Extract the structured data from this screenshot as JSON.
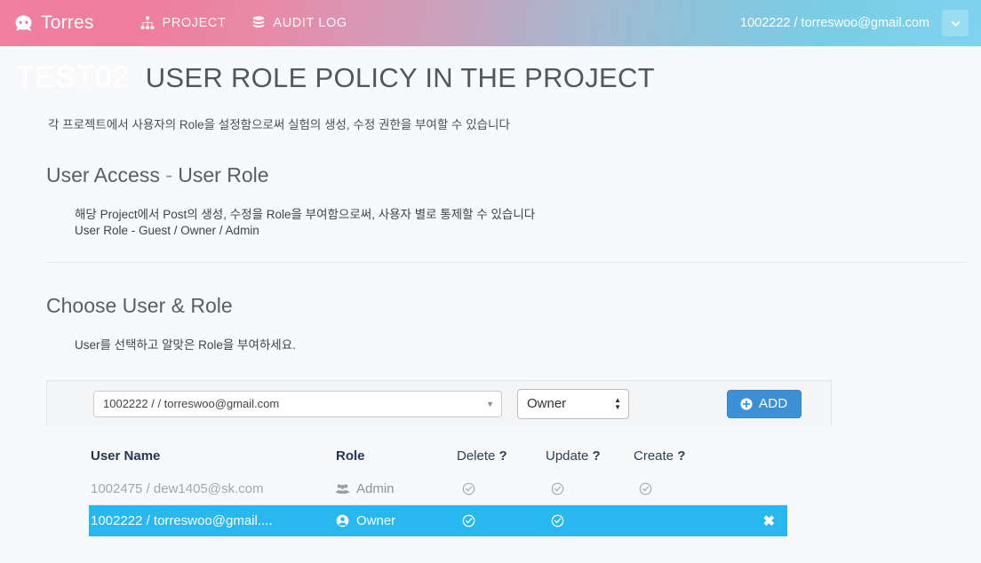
{
  "navbar": {
    "brand": "Torres",
    "brand_icon": "octoface-icon",
    "links": [
      {
        "label": "PROJECT",
        "icon": "sitemap-icon"
      },
      {
        "label": "AUDIT LOG",
        "icon": "database-icon"
      }
    ],
    "user": "1002222 / torreswoo@gmail.com",
    "caret_icon": "chevron-down-icon"
  },
  "page": {
    "project_tag": "TEST02",
    "title": "USER ROLE POLICY IN THE PROJECT",
    "lead": "각 프로젝트에서 사용자의 Role을 설정함으로써 실험의 생성, 수정 권한을 부여할 수 있습니다"
  },
  "section_access": {
    "title_main": "User Access",
    "title_dash": "-",
    "title_sub": "User Role",
    "body_line1": "해당 Project에서 Post의 생성, 수정을 Role을 부여함으로써, 사용자 별로 통제할 수 있습니다",
    "body_line2": "User Role - Guest / Owner / Admin"
  },
  "section_choose": {
    "title": "Choose User & Role",
    "body": "User를 선택하고 알맞은 Role을 부여하세요."
  },
  "form": {
    "user_select_value": "1002222 / / torreswoo@gmail.com",
    "user_select_caret": "caret-down-icon",
    "role_select_value": "Owner",
    "role_select_spinner": "spinner-icon",
    "add_button_label": "ADD",
    "add_button_icon": "plus-circle-icon"
  },
  "table": {
    "headers": {
      "user_name": "User Name",
      "role": "Role",
      "delete": "Delete",
      "update": "Update",
      "create": "Create",
      "help_mark": "?"
    },
    "rows": [
      {
        "user": "1002475 / dew1405@sk.com",
        "role": "Admin",
        "role_icon": "users-icon",
        "delete_icon": "check-circle-icon",
        "update_icon": "check-circle-icon",
        "create_icon": "check-circle-icon",
        "action": "",
        "highlighted": false
      },
      {
        "user": "1002222 / torreswoo@gmail....",
        "role": "Owner",
        "role_icon": "user-circle-icon",
        "delete_icon": "check-circle-icon",
        "update_icon": "check-circle-icon",
        "create_icon": "",
        "action_icon": "remove-x-icon",
        "action": "✖",
        "highlighted": true
      }
    ]
  },
  "colors": {
    "nav_gradient_start": "#f07fa0",
    "nav_gradient_end": "#7fd3ee",
    "row_highlight": "#29b7f0",
    "add_button": "#3c91d6",
    "page_bg": "#f8f9fb"
  }
}
